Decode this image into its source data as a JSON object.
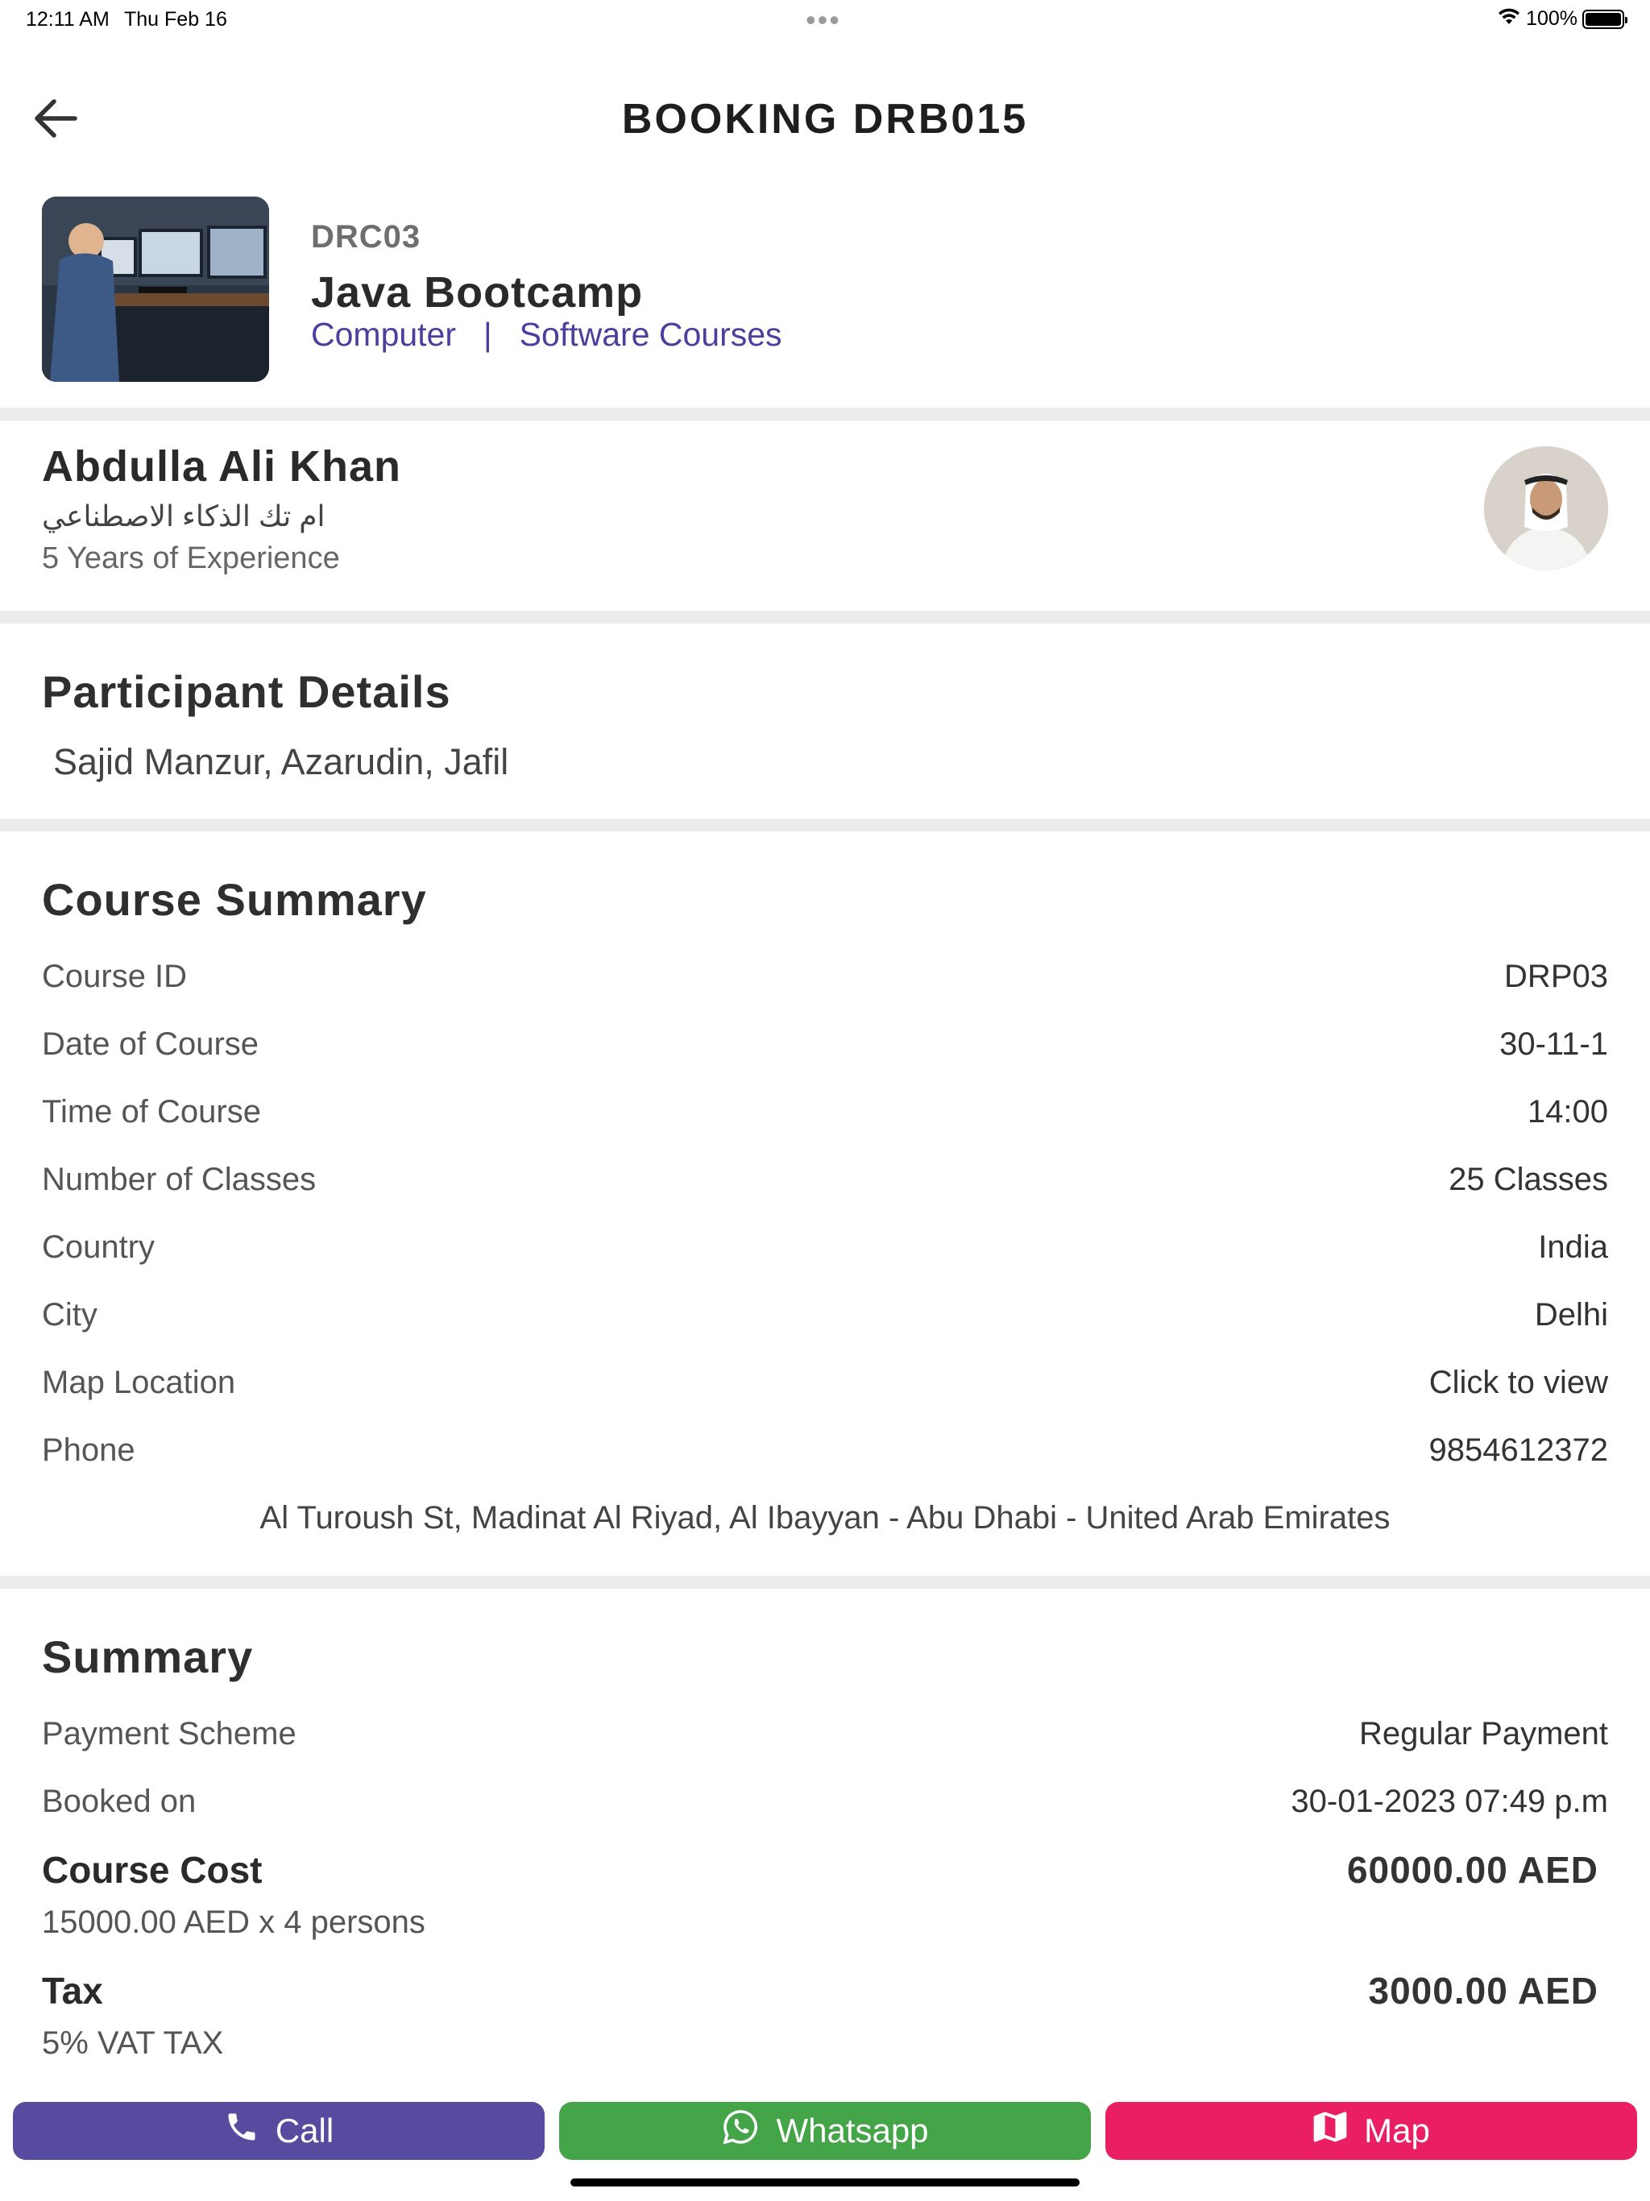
{
  "status_bar": {
    "time": "12:11 AM",
    "date": "Thu Feb 16",
    "dots": "•••",
    "battery": "100%"
  },
  "header": {
    "title": "BOOKING  DRB015"
  },
  "course": {
    "code": "DRC03",
    "title": "Java  Bootcamp",
    "category": "Computer",
    "separator": "|",
    "subcategory": "Software Courses"
  },
  "instructor": {
    "name": "Abdulla Ali Khan",
    "organization": "ام تك الذكاء الاصطناعي",
    "experience": "5 Years of Experience"
  },
  "participants": {
    "heading": "Participant Details",
    "names": "Sajid Manzur, Azarudin, Jafil"
  },
  "course_summary": {
    "heading": "Course Summary",
    "rows": [
      {
        "label": "Course ID",
        "value": "DRP03"
      },
      {
        "label": "Date of Course",
        "value": "30-11-1"
      },
      {
        "label": "Time of Course",
        "value": "14:00"
      },
      {
        "label": "Number of Classes",
        "value": "25 Classes"
      },
      {
        "label": "Country",
        "value": "India"
      },
      {
        "label": "City",
        "value": "Delhi"
      },
      {
        "label": "Map Location",
        "value": "Click to view"
      },
      {
        "label": "Phone",
        "value": "9854612372"
      }
    ],
    "address": "Al Turoush St, Madinat Al Riyad, Al  Ibayyan - Abu Dhabi - United Arab Emirates"
  },
  "summary": {
    "heading": "Summary",
    "payment_scheme_label": "Payment Scheme",
    "payment_scheme_value": "Regular Payment",
    "booked_on_label": "Booked on",
    "booked_on_value": "30-01-2023   07:49 p.m",
    "course_cost_label": "Course Cost",
    "course_cost_value": "60000.00 AED",
    "course_cost_detail": "15000.00 AED  x 4 persons",
    "tax_label": "Tax",
    "tax_value": "3000.00 AED",
    "tax_detail": "5% VAT TAX"
  },
  "actions": {
    "call_label": "Call",
    "whatsapp_label": "Whatsapp",
    "map_label": "Map"
  },
  "colors": {
    "primary": "#564b9e",
    "whatsapp": "#43a547",
    "map": "#e91e63",
    "link": "#4b3f9e",
    "divider": "#ececec"
  },
  "icons": {
    "back": "arrow-left-icon",
    "call": "phone-icon",
    "whatsapp": "whatsapp-icon",
    "map": "map-icon",
    "wifi": "wifi-icon",
    "battery": "battery-icon"
  }
}
